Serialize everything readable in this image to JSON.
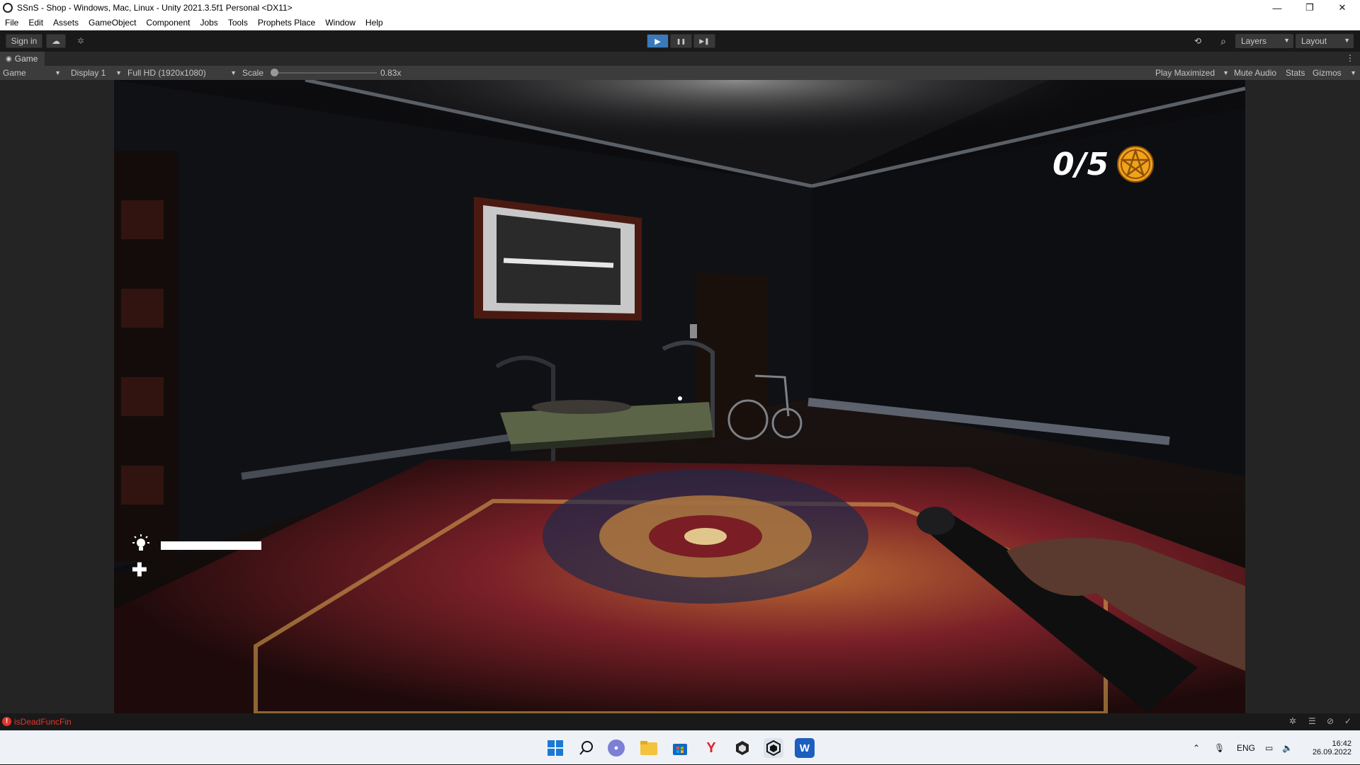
{
  "window": {
    "title": "SSnS - Shop - Windows, Mac, Linux - Unity 2021.3.5f1 Personal <DX11>",
    "minimize_glyph": "—",
    "restore_glyph": "❐",
    "close_glyph": "✕"
  },
  "menu": {
    "items": [
      "File",
      "Edit",
      "Assets",
      "GameObject",
      "Component",
      "Jobs",
      "Tools",
      "Prophets Place",
      "Window",
      "Help"
    ]
  },
  "toolbar": {
    "sign_in": "Sign in",
    "layers": "Layers",
    "layout": "Layout",
    "play_glyph": "▶",
    "pause_glyph": "❚❚",
    "step_glyph": "▶❚",
    "history_glyph": "⟲",
    "search_glyph": "⌕",
    "cloud_glyph": "☁",
    "collab_glyph": "✲"
  },
  "game_tab": {
    "label": "Game",
    "more_glyph": "⋮"
  },
  "game_toolbar": {
    "mode": "Game",
    "display": "Display 1",
    "resolution": "Full HD (1920x1080)",
    "scale_label": "Scale",
    "scale_value_text": "0.83x",
    "scale_value": 0.83,
    "play_maximized": "Play Maximized",
    "mute_audio": "Mute Audio",
    "stats": "Stats",
    "gizmos": "Gizmos"
  },
  "hud": {
    "collected_text": "0/5",
    "collected": 0,
    "total": 5,
    "flashlight_battery_fraction": 1.0,
    "health_glyph": "✚",
    "colors": {
      "pentagram": "#f2a21b",
      "hud_text": "#ffffff"
    }
  },
  "status": {
    "error_message": "isDeadFuncFin",
    "error_color": "#e0352b"
  },
  "taskbar": {
    "apps": [
      "windows-start",
      "search",
      "chat",
      "file-explorer",
      "store",
      "yandex-browser",
      "unity-hub",
      "unity-editor",
      "word"
    ],
    "word_letter": "W",
    "yandex_letter": "Y",
    "language": "ENG",
    "time": "16:42",
    "date": "26.09.2022"
  }
}
